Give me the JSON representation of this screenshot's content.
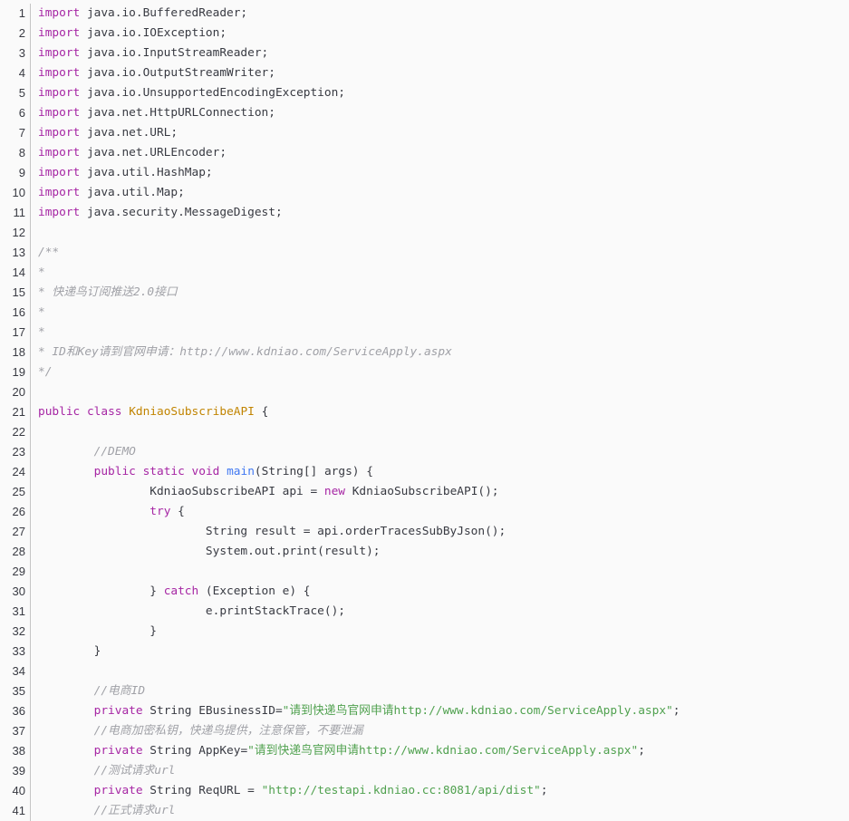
{
  "code": {
    "lines": [
      {
        "n": "1",
        "tokens": [
          {
            "t": "kw",
            "v": "import"
          },
          {
            "t": "pl",
            "v": " java.io.BufferedReader;"
          }
        ]
      },
      {
        "n": "2",
        "tokens": [
          {
            "t": "kw",
            "v": "import"
          },
          {
            "t": "pl",
            "v": " java.io.IOException;"
          }
        ]
      },
      {
        "n": "3",
        "tokens": [
          {
            "t": "kw",
            "v": "import"
          },
          {
            "t": "pl",
            "v": " java.io.InputStreamReader;"
          }
        ]
      },
      {
        "n": "4",
        "tokens": [
          {
            "t": "kw",
            "v": "import"
          },
          {
            "t": "pl",
            "v": " java.io.OutputStreamWriter;"
          }
        ]
      },
      {
        "n": "5",
        "tokens": [
          {
            "t": "kw",
            "v": "import"
          },
          {
            "t": "pl",
            "v": " java.io.UnsupportedEncodingException;"
          }
        ]
      },
      {
        "n": "6",
        "tokens": [
          {
            "t": "kw",
            "v": "import"
          },
          {
            "t": "pl",
            "v": " java.net.HttpURLConnection;"
          }
        ]
      },
      {
        "n": "7",
        "tokens": [
          {
            "t": "kw",
            "v": "import"
          },
          {
            "t": "pl",
            "v": " java.net.URL;"
          }
        ]
      },
      {
        "n": "8",
        "tokens": [
          {
            "t": "kw",
            "v": "import"
          },
          {
            "t": "pl",
            "v": " java.net.URLEncoder;"
          }
        ]
      },
      {
        "n": "9",
        "tokens": [
          {
            "t": "kw",
            "v": "import"
          },
          {
            "t": "pl",
            "v": " java.util.HashMap;"
          }
        ]
      },
      {
        "n": "10",
        "tokens": [
          {
            "t": "kw",
            "v": "import"
          },
          {
            "t": "pl",
            "v": " java.util.Map;"
          }
        ]
      },
      {
        "n": "11",
        "tokens": [
          {
            "t": "kw",
            "v": "import"
          },
          {
            "t": "pl",
            "v": " java.security.MessageDigest;"
          }
        ]
      },
      {
        "n": "12",
        "tokens": []
      },
      {
        "n": "13",
        "tokens": [
          {
            "t": "cm",
            "v": "/**"
          }
        ]
      },
      {
        "n": "14",
        "tokens": [
          {
            "t": "cm",
            "v": "*"
          }
        ]
      },
      {
        "n": "15",
        "tokens": [
          {
            "t": "cm",
            "v": "* 快递鸟订阅推送2.0接口"
          }
        ]
      },
      {
        "n": "16",
        "tokens": [
          {
            "t": "cm",
            "v": "*"
          }
        ]
      },
      {
        "n": "17",
        "tokens": [
          {
            "t": "cm",
            "v": "*"
          }
        ]
      },
      {
        "n": "18",
        "tokens": [
          {
            "t": "cm",
            "v": "* ID和Key请到官网申请：http://www.kdniao.com/ServiceApply.aspx"
          }
        ]
      },
      {
        "n": "19",
        "tokens": [
          {
            "t": "cm",
            "v": "*/"
          }
        ]
      },
      {
        "n": "20",
        "tokens": []
      },
      {
        "n": "21",
        "tokens": [
          {
            "t": "kw",
            "v": "public"
          },
          {
            "t": "pl",
            "v": " "
          },
          {
            "t": "kw",
            "v": "class"
          },
          {
            "t": "pl",
            "v": " "
          },
          {
            "t": "cls",
            "v": "KdniaoSubscribeAPI"
          },
          {
            "t": "pl",
            "v": " {"
          }
        ]
      },
      {
        "n": "22",
        "tokens": []
      },
      {
        "n": "23",
        "tokens": [
          {
            "t": "pl",
            "v": "        "
          },
          {
            "t": "cm",
            "v": "//DEMO"
          }
        ]
      },
      {
        "n": "24",
        "tokens": [
          {
            "t": "pl",
            "v": "        "
          },
          {
            "t": "kw",
            "v": "public"
          },
          {
            "t": "pl",
            "v": " "
          },
          {
            "t": "kw",
            "v": "static"
          },
          {
            "t": "pl",
            "v": " "
          },
          {
            "t": "kw",
            "v": "void"
          },
          {
            "t": "pl",
            "v": " "
          },
          {
            "t": "fn",
            "v": "main"
          },
          {
            "t": "pl",
            "v": "(String[] args) {"
          }
        ]
      },
      {
        "n": "25",
        "tokens": [
          {
            "t": "pl",
            "v": "                KdniaoSubscribeAPI api = "
          },
          {
            "t": "kw",
            "v": "new"
          },
          {
            "t": "pl",
            "v": " KdniaoSubscribeAPI();"
          }
        ]
      },
      {
        "n": "26",
        "tokens": [
          {
            "t": "pl",
            "v": "                "
          },
          {
            "t": "kw",
            "v": "try"
          },
          {
            "t": "pl",
            "v": " {"
          }
        ]
      },
      {
        "n": "27",
        "tokens": [
          {
            "t": "pl",
            "v": "                        String result = api.orderTracesSubByJson();"
          }
        ]
      },
      {
        "n": "28",
        "tokens": [
          {
            "t": "pl",
            "v": "                        System.out.print(result);"
          }
        ]
      },
      {
        "n": "29",
        "tokens": []
      },
      {
        "n": "30",
        "tokens": [
          {
            "t": "pl",
            "v": "                } "
          },
          {
            "t": "kw",
            "v": "catch"
          },
          {
            "t": "pl",
            "v": " (Exception e) {"
          }
        ]
      },
      {
        "n": "31",
        "tokens": [
          {
            "t": "pl",
            "v": "                        e.printStackTrace();"
          }
        ]
      },
      {
        "n": "32",
        "tokens": [
          {
            "t": "pl",
            "v": "                }"
          }
        ]
      },
      {
        "n": "33",
        "tokens": [
          {
            "t": "pl",
            "v": "        }"
          }
        ]
      },
      {
        "n": "34",
        "tokens": []
      },
      {
        "n": "35",
        "tokens": [
          {
            "t": "pl",
            "v": "        "
          },
          {
            "t": "cm",
            "v": "//电商ID"
          }
        ]
      },
      {
        "n": "36",
        "tokens": [
          {
            "t": "pl",
            "v": "        "
          },
          {
            "t": "kw",
            "v": "private"
          },
          {
            "t": "pl",
            "v": " String EBusinessID="
          },
          {
            "t": "str",
            "v": "\"请到快递鸟官网申请http://www.kdniao.com/ServiceApply.aspx\""
          },
          {
            "t": "pl",
            "v": ";"
          }
        ]
      },
      {
        "n": "37",
        "tokens": [
          {
            "t": "pl",
            "v": "        "
          },
          {
            "t": "cm",
            "v": "//电商加密私钥，快递鸟提供，注意保管，不要泄漏"
          }
        ]
      },
      {
        "n": "38",
        "tokens": [
          {
            "t": "pl",
            "v": "        "
          },
          {
            "t": "kw",
            "v": "private"
          },
          {
            "t": "pl",
            "v": " String AppKey="
          },
          {
            "t": "str",
            "v": "\"请到快递鸟官网申请http://www.kdniao.com/ServiceApply.aspx\""
          },
          {
            "t": "pl",
            "v": ";"
          }
        ]
      },
      {
        "n": "39",
        "tokens": [
          {
            "t": "pl",
            "v": "        "
          },
          {
            "t": "cm",
            "v": "//测试请求url"
          }
        ]
      },
      {
        "n": "40",
        "tokens": [
          {
            "t": "pl",
            "v": "        "
          },
          {
            "t": "kw",
            "v": "private"
          },
          {
            "t": "pl",
            "v": " String ReqURL = "
          },
          {
            "t": "str",
            "v": "\"http://testapi.kdniao.cc:8081/api/dist\""
          },
          {
            "t": "pl",
            "v": ";"
          }
        ]
      },
      {
        "n": "41",
        "tokens": [
          {
            "t": "pl",
            "v": "        "
          },
          {
            "t": "cm",
            "v": "//正式请求url"
          }
        ]
      }
    ]
  },
  "colors": {
    "keyword": "#a626a4",
    "class_name": "#c18401",
    "function": "#4078f2",
    "string": "#50a14f",
    "comment": "#a0a1a7",
    "plain": "#383a42",
    "background": "#fafafa"
  }
}
